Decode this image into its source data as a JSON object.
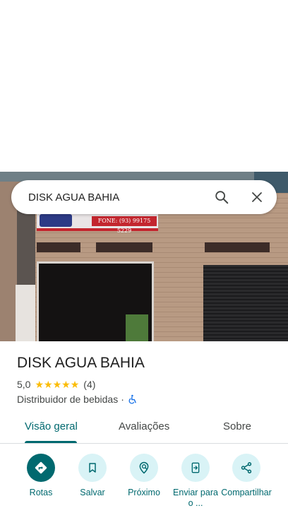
{
  "search": {
    "query": "DISK AGUA BAHIA"
  },
  "photo": {
    "sign_phone": "FONE: (93) 99175 5229"
  },
  "place": {
    "title": "DISK AGUA BAHIA",
    "rating": "5,0",
    "stars": 5,
    "review_count": "(4)",
    "category": "Distribuidor de bebidas",
    "separator": "·"
  },
  "tabs": [
    {
      "label": "Visão geral",
      "active": true
    },
    {
      "label": "Avaliações",
      "active": false
    },
    {
      "label": "Sobre",
      "active": false
    }
  ],
  "actions": [
    {
      "label": "Rotas",
      "icon": "directions-icon"
    },
    {
      "label": "Salvar",
      "icon": "bookmark-icon"
    },
    {
      "label": "Próximo",
      "icon": "nearby-icon"
    },
    {
      "label": "Enviar para o ...",
      "icon": "send-to-phone-icon"
    },
    {
      "label": "Compartilhar",
      "icon": "share-icon"
    }
  ],
  "colors": {
    "accent": "#00696f",
    "accent_light": "#d9f3f6",
    "star": "#fbbc04",
    "accessibility": "#1a73e8"
  }
}
